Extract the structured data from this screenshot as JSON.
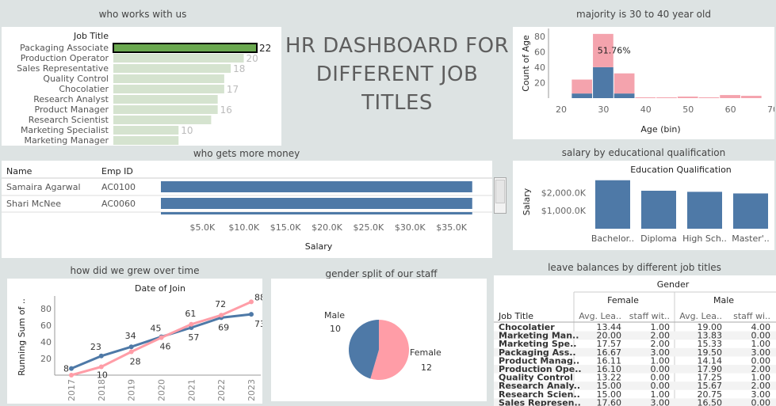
{
  "titles": {
    "who_works": "who works with us",
    "age": "majority is 30 to 40 year old",
    "money": "who gets more money",
    "education": "salary by educational qualification",
    "growth": "how did we grew over time",
    "gender": "gender split of our staff",
    "leave": "leave balances by different job titles"
  },
  "dashboard_title": "HR DASHBOARD FOR DIFFERENT JOB TITLES",
  "colors": {
    "green": "#6aa84f",
    "light_green": "#d5e3cf",
    "blue": "#4e79a7",
    "pink": "#ff9da7",
    "pink_light": "#f4a3ad"
  },
  "chart_data": [
    {
      "type": "bar",
      "id": "job-titles",
      "column_header": "Job Title",
      "categories": [
        "Packaging Associate",
        "Production Operator",
        "Sales Representative",
        "Quality Control",
        "Chocolatier",
        "Research Analyst",
        "Product Manager",
        "Research Scientist",
        "Marketing Specialist",
        "Marketing Manager"
      ],
      "values": [
        22,
        20,
        18,
        17,
        17,
        16,
        16,
        15,
        10,
        10
      ],
      "labels": [
        "22",
        "20",
        "18",
        "",
        "17",
        "",
        "16",
        "",
        "10",
        ""
      ]
    },
    {
      "type": "bar",
      "id": "age-histogram",
      "xlabel": "Age (bin)",
      "ylabel": "Count of Age",
      "x_ticks": [
        20,
        30,
        40,
        50,
        60,
        70
      ],
      "y_ticks": [
        20,
        40,
        60,
        80
      ],
      "xlim": [
        17,
        70
      ],
      "ylim": [
        0,
        90
      ],
      "bin_width": 5,
      "annotation": "51.76%",
      "series": [
        {
          "bins": [
            25,
            30,
            35,
            40,
            45,
            50,
            55,
            60,
            65
          ],
          "values": [
            6,
            40,
            6,
            0,
            0,
            0,
            0,
            0,
            0
          ]
        },
        {
          "bins": [
            25,
            30,
            35,
            40,
            45,
            50,
            55,
            60,
            65
          ],
          "values": [
            18,
            43,
            26,
            1,
            1,
            2,
            1,
            4,
            3
          ]
        }
      ]
    },
    {
      "type": "bar",
      "id": "salary",
      "xlabel": "Salary",
      "headers": [
        "Name",
        "Emp ID"
      ],
      "rows": [
        {
          "name": "Samaira Agarwal",
          "id": "AC0100",
          "value": 37500
        },
        {
          "name": "Shari McNee",
          "id": "AC0060",
          "value": 37500
        }
      ],
      "x_ticks": [
        "$5.0K",
        "$10.0K",
        "$15.0K",
        "$20.0K",
        "$25.0K",
        "$30.0K",
        "$35.0K"
      ],
      "x_tick_values": [
        5000,
        10000,
        15000,
        20000,
        25000,
        30000,
        35000
      ],
      "xlim": [
        0,
        38000
      ]
    },
    {
      "type": "bar",
      "id": "education",
      "title": "Education Qualification",
      "ylabel": "Salary",
      "categories": [
        "Bachelor..",
        "Diploma",
        "High Sch..",
        "Master'.."
      ],
      "values": [
        2680,
        2100,
        2040,
        1950
      ],
      "y_ticks": [
        "$1,000.0K",
        "$2,000.0K"
      ],
      "y_tick_values": [
        1000,
        2000
      ],
      "ylim": [
        0,
        2800
      ]
    },
    {
      "type": "line",
      "id": "growth",
      "title": "Date of Join",
      "ylabel": "Running Sum of ..",
      "x": [
        "2017",
        "2018",
        "2019",
        "2020",
        "2021",
        "2022",
        "2023"
      ],
      "y_ticks": [
        20,
        40,
        60,
        80
      ],
      "ylim": [
        0,
        95
      ],
      "series": [
        {
          "values": [
            8,
            23,
            34,
            46,
            57,
            69,
            73
          ]
        },
        {
          "values": [
            0,
            10,
            28,
            45,
            61,
            72,
            88
          ]
        }
      ],
      "labels_blue": [
        "8",
        "23",
        "34",
        "46",
        "57",
        "69",
        "73"
      ],
      "labels_pink": [
        "",
        "10",
        "28",
        "45",
        "61",
        "72",
        "88"
      ]
    },
    {
      "type": "pie",
      "id": "gender",
      "slices": [
        {
          "label": "Male",
          "value": 10
        },
        {
          "label": "Female",
          "value": 12
        }
      ],
      "value_labels": [
        "10",
        "12"
      ]
    },
    {
      "type": "table",
      "id": "leave",
      "group_header": "Gender",
      "groups": [
        "Female",
        "Male"
      ],
      "row_header": "Job Title",
      "columns": [
        "Avg. Lea..",
        "staff wit..",
        "Avg. Lea..",
        "staff wi.."
      ],
      "rows": [
        [
          "Chocolatier",
          "13.44",
          "1.00",
          "19.00",
          "4.00"
        ],
        [
          "Marketing Man..",
          "20.00",
          "2.00",
          "13.83",
          "0.00"
        ],
        [
          "Marketing Spe..",
          "17.57",
          "2.00",
          "15.33",
          "1.00"
        ],
        [
          "Packaging Ass..",
          "16.67",
          "3.00",
          "19.50",
          "3.00"
        ],
        [
          "Product Manag..",
          "16.11",
          "1.00",
          "14.14",
          "0.00"
        ],
        [
          "Production Ope..",
          "16.10",
          "0.00",
          "17.90",
          "2.00"
        ],
        [
          "Quality Control",
          "13.22",
          "0.00",
          "17.25",
          "1.00"
        ],
        [
          "Research Analy..",
          "15.00",
          "0.00",
          "15.67",
          "2.00"
        ],
        [
          "Research Scien..",
          "15.00",
          "1.00",
          "20.75",
          "3.00"
        ],
        [
          "Sales Represen..",
          "17.60",
          "3.00",
          "16.50",
          "0.00"
        ]
      ]
    }
  ]
}
